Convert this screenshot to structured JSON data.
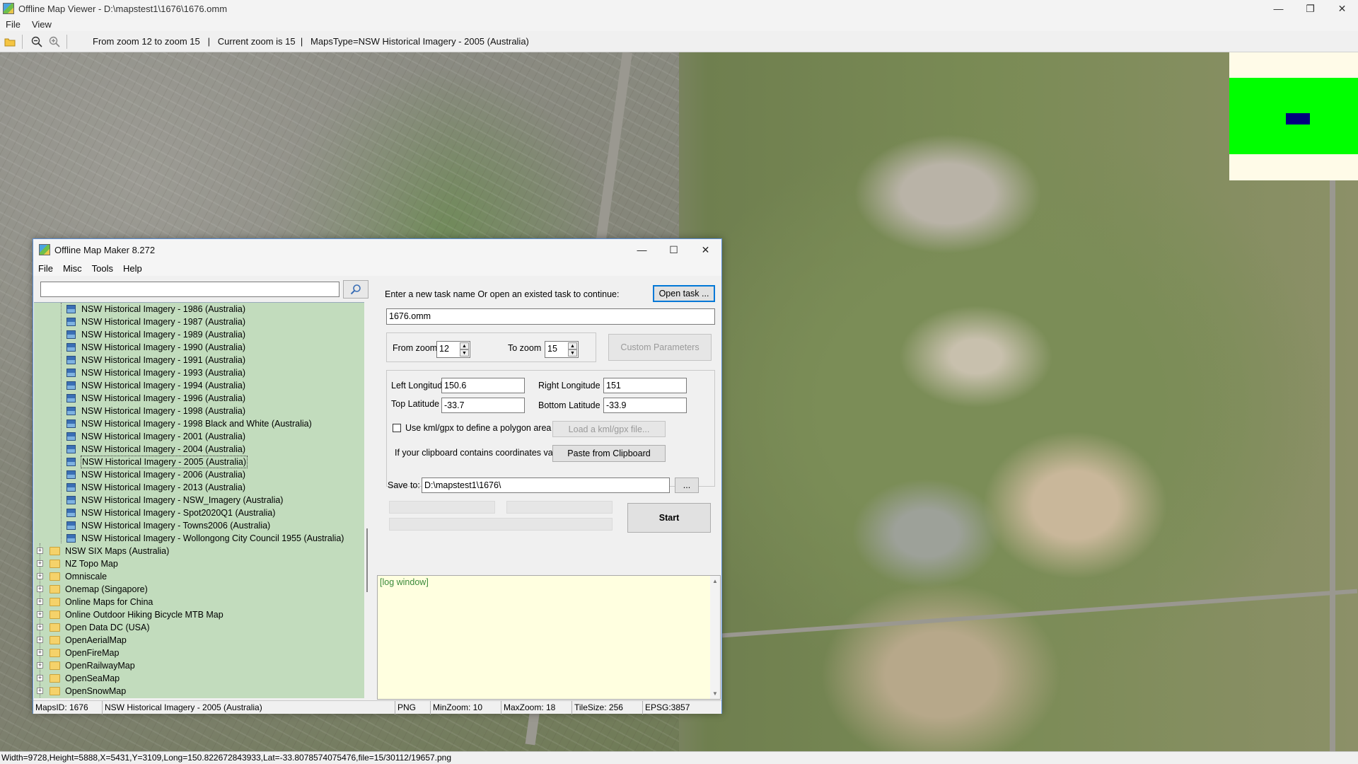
{
  "window": {
    "title": "Offline Map Viewer - D:\\mapstest1\\1676\\1676.omm",
    "controls": {
      "minimize": "—",
      "restore": "❐",
      "close": "✕"
    }
  },
  "menu": [
    "File",
    "View"
  ],
  "toolbar": {
    "info": "From zoom 12 to zoom 15   |   Current zoom is 15  |   MapsType=NSW Historical Imagery - 2005 (Australia)"
  },
  "statusbar": {
    "text": "Width=9728,Height=5888,X=5431,Y=3109,Long=150.822672843933,Lat=-33.8078574075476,file=15/30112/19657.png"
  },
  "dialog": {
    "title": "Offline Map Maker 8.272",
    "menu": [
      "File",
      "Misc",
      "Tools",
      "Help"
    ],
    "search": {
      "value": "",
      "placeholder": ""
    },
    "tree_leaves": [
      "NSW Historical Imagery - 1986 (Australia)",
      "NSW Historical Imagery - 1987 (Australia)",
      "NSW Historical Imagery - 1989 (Australia)",
      "NSW Historical Imagery - 1990 (Australia)",
      "NSW Historical Imagery - 1991 (Australia)",
      "NSW Historical Imagery - 1993 (Australia)",
      "NSW Historical Imagery - 1994 (Australia)",
      "NSW Historical Imagery - 1996 (Australia)",
      "NSW Historical Imagery - 1998 (Australia)",
      "NSW Historical Imagery - 1998 Black and White (Australia)",
      "NSW Historical Imagery - 2001 (Australia)",
      "NSW Historical Imagery - 2004 (Australia)",
      "NSW Historical Imagery - 2005 (Australia)",
      "NSW Historical Imagery - 2006 (Australia)",
      "NSW Historical Imagery - 2013 (Australia)",
      "NSW Historical Imagery - NSW_Imagery (Australia)",
      "NSW Historical Imagery - Spot2020Q1 (Australia)",
      "NSW Historical Imagery - Towns2006 (Australia)",
      "NSW Historical Imagery - Wollongong City Council 1955 (Australia)"
    ],
    "selected_leaf": "NSW Historical Imagery - 2005 (Australia)",
    "tree_folders": [
      "NSW SIX Maps (Australia)",
      "NZ Topo Map",
      "Omniscale",
      "Onemap (Singapore)",
      "Online Maps for China",
      "Online Outdoor Hiking Bicycle MTB Map",
      "Open Data DC (USA)",
      "OpenAerialMap",
      "OpenFireMap",
      "OpenRailwayMap",
      "OpenSeaMap",
      "OpenSnowMap"
    ],
    "task_prompt": "Enter a new task name Or open an existed task to continue:",
    "open_task_label": "Open task ...",
    "task_name": "1676.omm",
    "from_zoom_label": "From zoom",
    "from_zoom": "12",
    "to_zoom_label": "To zoom",
    "to_zoom": "15",
    "custom_params_label": "Custom Parameters",
    "left_lon_label": "Left Longitude",
    "left_lon": "150.6",
    "right_lon_label": "Right Longitude",
    "right_lon": "151",
    "top_lat_label": "Top Latitude",
    "top_lat": "-33.7",
    "bottom_lat_label": "Bottom Latitude",
    "bottom_lat": "-33.9",
    "kml_label": "Use kml/gpx to define a polygon area",
    "load_kml_label": "Load a kml/gpx file...",
    "clipboard_prompt": "If your clipboard contains coordinates values:",
    "paste_label": "Paste from Clipboard",
    "save_to_label": "Save to:",
    "save_path": "D:\\mapstest1\\1676\\",
    "browse_label": "...",
    "start_label": "Start",
    "log_text": "[log window]",
    "status": {
      "maps_id": "MapsID: 1676",
      "map_name": "NSW Historical Imagery - 2005 (Australia)",
      "format": "PNG",
      "min_zoom": "MinZoom: 10",
      "max_zoom": "MaxZoom: 18",
      "tile_size": "TileSize: 256",
      "epsg": "EPSG:3857"
    }
  }
}
